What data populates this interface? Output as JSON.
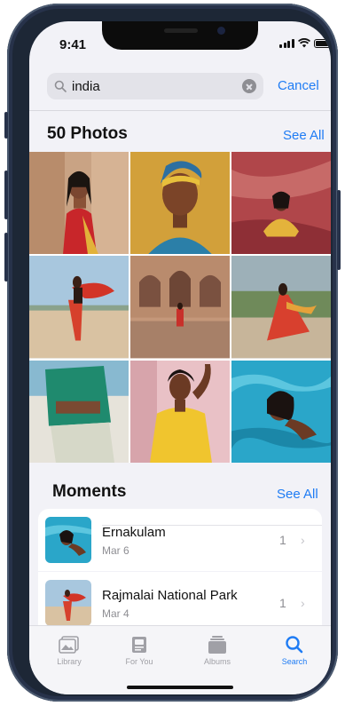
{
  "status_bar": {
    "time": "9:41"
  },
  "search": {
    "query": "india",
    "cancel_label": "Cancel"
  },
  "photos_section": {
    "title": "50 Photos",
    "see_all_label": "See All"
  },
  "moments_section": {
    "title": "Moments",
    "see_all_label": "See All",
    "items": [
      {
        "title": "Ernakulam",
        "date": "Mar 6",
        "count": "1"
      },
      {
        "title": "Rajmalai National Park",
        "date": "Mar 4",
        "count": "1"
      }
    ]
  },
  "tab_bar": {
    "tabs": [
      {
        "label": "Library",
        "icon": "photo-library-icon",
        "active": false
      },
      {
        "label": "For You",
        "icon": "for-you-icon",
        "active": false
      },
      {
        "label": "Albums",
        "icon": "albums-icon",
        "active": false
      },
      {
        "label": "Search",
        "icon": "search-icon",
        "active": true
      }
    ]
  },
  "colors": {
    "accent": "#1f7cf4",
    "phone_frame": "#1d2736"
  }
}
